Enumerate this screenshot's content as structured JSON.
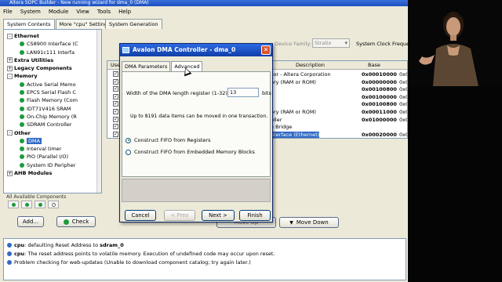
{
  "window": {
    "title": "Altera SOPC Builder - New running wizard for dma_0 (DMA)"
  },
  "menu": [
    "File",
    "System",
    "Module",
    "View",
    "Tools",
    "Help"
  ],
  "left_tabs": [
    "System Contents",
    "More \"cpu\" Settings"
  ],
  "sysgen_tab": "System Generation",
  "tree": [
    {
      "label": "Ethernet",
      "kind": "cat",
      "expander": "-"
    },
    {
      "label": "CS8900 Interface (C",
      "kind": "leaf"
    },
    {
      "label": "LAN91c111 Interfa",
      "kind": "leaf"
    },
    {
      "label": "Extra Utilities",
      "kind": "cat",
      "expander": "+"
    },
    {
      "label": "Legacy Components",
      "kind": "cat",
      "expander": "+"
    },
    {
      "label": "Memory",
      "kind": "cat",
      "expander": "-"
    },
    {
      "label": "Active Serial Memo",
      "kind": "leaf"
    },
    {
      "label": "EPCS Serial Flash C",
      "kind": "leaf"
    },
    {
      "label": "Flash Memory (Com",
      "kind": "leaf"
    },
    {
      "label": "IDT71V416 SRAM",
      "kind": "leaf"
    },
    {
      "label": "On-Chip Memory (R",
      "kind": "leaf"
    },
    {
      "label": "SDRAM Controller",
      "kind": "leaf"
    },
    {
      "label": "Other",
      "kind": "cat",
      "expander": "-"
    },
    {
      "label": "DMA",
      "kind": "leaf",
      "selected": true
    },
    {
      "label": "Interval timer",
      "kind": "leaf"
    },
    {
      "label": "PIO (Parallel I/O)",
      "kind": "leaf"
    },
    {
      "label": "System ID Peripher",
      "kind": "leaf"
    },
    {
      "label": "AHB Modules",
      "kind": "cat",
      "expander": "+"
    }
  ],
  "all_available_label": "All Available Components",
  "add_label": "Add...",
  "check_label": "Check",
  "device_family_label": "Device Family:",
  "device_family_value": "Stratix",
  "sys_clock_label": "System Clock Freque",
  "table": {
    "headers": {
      "use": "Use",
      "description": "Description",
      "base": "Base"
    },
    "rows": [
      {
        "description": "sor - Altera Corporation",
        "base": "0x00010000",
        "end": "0x0",
        "checked": true
      },
      {
        "description": "ory (RAM or ROM)",
        "base": "0x00000000",
        "end": "0x0",
        "checked": true
      },
      {
        "description": "",
        "base": "0x00100800",
        "end": "0x0",
        "checked": true
      },
      {
        "description": "",
        "base": "0x00100000",
        "end": "0x0",
        "checked": true
      },
      {
        "description": "",
        "base": "0x00100800",
        "end": "0x0",
        "checked": true
      },
      {
        "description": "ory (RAM or ROM)",
        "base": "0x00011000",
        "end": "0x0",
        "checked": true
      },
      {
        "description": "oller",
        "base": "0x01000000",
        "end": "0x0",
        "checked": true
      },
      {
        "description": "e Bridge",
        "base": "",
        "end": "",
        "checked": true
      },
      {
        "description": "nterface (Ethernet)",
        "base": "0x00020000",
        "end": "0x0",
        "checked": true,
        "selected": true
      }
    ]
  },
  "move_up_label": "Move Up",
  "move_down_label": "Move Down",
  "messages": [
    {
      "source": "cpu",
      "text": ": defaulting Reset Address to ",
      "target": "sdram_0"
    },
    {
      "source": "cpu",
      "text": ": The reset address points to volatile memory. Execution of undefined code may occur upon reset.",
      "target": ""
    },
    {
      "source": "",
      "text": "Problem checking for web-updates (Unable to download component catalog; try again later.)",
      "target": ""
    }
  ],
  "dialog": {
    "title": "Avalon DMA Controller - dma_0",
    "tabs": [
      "DMA Parameters",
      "Advanced"
    ],
    "width_label": "Width of the DMA length register (1-32):",
    "width_value": "13",
    "bits_label": "bits",
    "info_text": "Up to 8191 data items can be moved in one transaction.",
    "radio_registers": "Construct FIFO from Registers",
    "radio_embedded": "Construct FIFO from Embedded Memory Blocks",
    "cancel_label": "Cancel",
    "prev_label": "< Prev",
    "next_label": "Next >",
    "finish_label": "Finish"
  }
}
